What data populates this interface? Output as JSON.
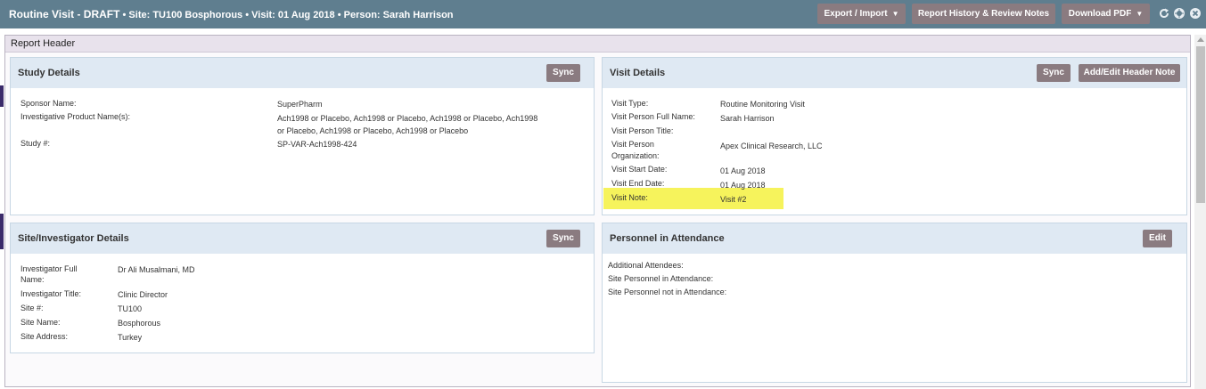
{
  "header": {
    "title": "Routine Visit - DRAFT",
    "meta": "• Site: TU100 Bosphorous • Visit: 01 Aug 2018 • Person: Sarah Harrison",
    "buttons": {
      "export": "Export / Import",
      "history": "Report History & Review Notes",
      "download": "Download PDF"
    },
    "icons": [
      "refresh-icon",
      "globe-icon",
      "close-icon"
    ]
  },
  "report_header": {
    "title": "Report Header"
  },
  "study_details": {
    "title": "Study Details",
    "sync": "Sync",
    "fields": [
      {
        "label": "Sponsor Name:",
        "value": "SuperPharm"
      },
      {
        "label": "Investigative Product Name(s):",
        "value_lines": [
          "Ach1998 or Placebo, Ach1998 or Placebo, Ach1998 or Placebo, Ach1998",
          "or Placebo, Ach1998 or Placebo, Ach1998 or Placebo"
        ]
      },
      {
        "label": "Study #:",
        "value": "SP-VAR-Ach1998-424"
      }
    ]
  },
  "visit_details": {
    "title": "Visit Details",
    "sync": "Sync",
    "add_note": "Add/Edit Header Note",
    "fields": [
      {
        "label": "Visit Type:",
        "value": "Routine Monitoring Visit"
      },
      {
        "label": "Visit Person Full Name:",
        "value": "Sarah Harrison"
      },
      {
        "label": "Visit Person Title:",
        "value": ""
      },
      {
        "label_lines": [
          "Visit Person",
          "Organization:"
        ],
        "value": "Apex Clinical Research, LLC"
      },
      {
        "label": "Visit Start Date:",
        "value": "01 Aug 2018"
      },
      {
        "label": "Visit End Date:",
        "value": "01 Aug 2018"
      },
      {
        "label": "Visit Note:",
        "value": "Visit #2"
      }
    ]
  },
  "site_details": {
    "title": "Site/Investigator Details",
    "sync": "Sync",
    "fields": [
      {
        "label_lines": [
          "Investigator Full",
          "Name:"
        ],
        "value": "Dr Ali Musalmani, MD"
      },
      {
        "label": "Investigator Title:",
        "value": "Clinic Director"
      },
      {
        "label": "Site #:",
        "value": "TU100"
      },
      {
        "label": "Site Name:",
        "value": "Bosphorous"
      },
      {
        "label": "Site Address:",
        "value": "Turkey"
      }
    ]
  },
  "personnel": {
    "title": "Personnel in Attendance",
    "edit": "Edit",
    "fields": [
      {
        "label": "Additional Attendees:"
      },
      {
        "label": "Site Personnel in Attendance:"
      },
      {
        "label": "Site Personnel not in Attendance:"
      }
    ]
  },
  "colors": {
    "topbar": "#5f7e8f",
    "button": "#8a7b80",
    "panel_header": "#dfe9f3",
    "highlight": "#f6f35c"
  }
}
